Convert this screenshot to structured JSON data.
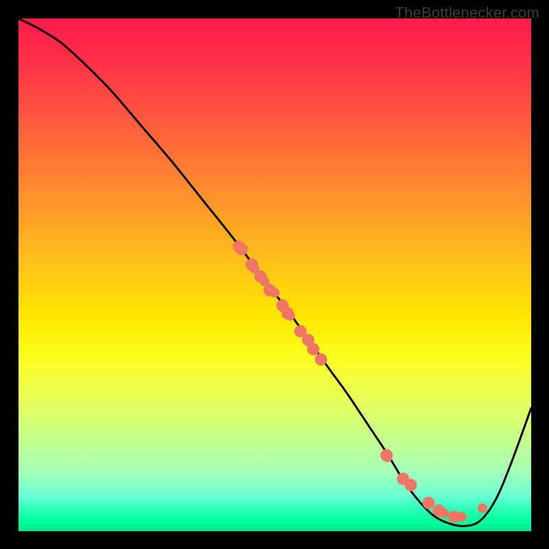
{
  "watermark": "TheBottlenecker.com",
  "chart_data": {
    "type": "line",
    "title": "",
    "xlabel": "",
    "ylabel": "",
    "xlim": [
      0,
      100
    ],
    "ylim": [
      0,
      100
    ],
    "grid": false,
    "curve": {
      "x": [
        0,
        4,
        8,
        12,
        18,
        24,
        30,
        36,
        42,
        48,
        54,
        60,
        64,
        68,
        72,
        75,
        78,
        81,
        84,
        87,
        90,
        93,
        96,
        100
      ],
      "y": [
        100,
        98,
        95.5,
        92,
        86,
        79,
        72,
        64.5,
        57,
        49,
        41,
        32.5,
        27,
        21,
        15,
        10,
        6,
        3,
        1.5,
        1,
        2,
        6,
        13,
        24
      ]
    },
    "markers": [
      {
        "x": 43.0,
        "y": 55.5,
        "r": 9
      },
      {
        "x": 43.5,
        "y": 55.0,
        "r": 9
      },
      {
        "x": 45.5,
        "y": 52.0,
        "r": 9
      },
      {
        "x": 46.0,
        "y": 51.2,
        "r": 7
      },
      {
        "x": 47.2,
        "y": 49.7,
        "r": 9
      },
      {
        "x": 48.0,
        "y": 48.7,
        "r": 7
      },
      {
        "x": 49.0,
        "y": 47.0,
        "r": 9
      },
      {
        "x": 50.0,
        "y": 46.5,
        "r": 7
      },
      {
        "x": 51.5,
        "y": 44.0,
        "r": 9
      },
      {
        "x": 52.5,
        "y": 42.5,
        "r": 9
      },
      {
        "x": 53.0,
        "y": 42.0,
        "r": 7
      },
      {
        "x": 55.0,
        "y": 39.0,
        "r": 9
      },
      {
        "x": 56.5,
        "y": 37.3,
        "r": 9
      },
      {
        "x": 57.5,
        "y": 35.5,
        "r": 9
      },
      {
        "x": 59.0,
        "y": 33.5,
        "r": 9
      },
      {
        "x": 71.8,
        "y": 14.8,
        "r": 9
      },
      {
        "x": 72.0,
        "y": 14.4,
        "r": 7
      },
      {
        "x": 75.0,
        "y": 10.2,
        "r": 9
      },
      {
        "x": 76.5,
        "y": 9.0,
        "r": 9
      },
      {
        "x": 80.0,
        "y": 5.5,
        "r": 9
      },
      {
        "x": 82.0,
        "y": 4.0,
        "r": 9
      },
      {
        "x": 83.0,
        "y": 3.5,
        "r": 7
      },
      {
        "x": 85.0,
        "y": 2.8,
        "r": 9
      },
      {
        "x": 86.5,
        "y": 2.8,
        "r": 7
      },
      {
        "x": 90.5,
        "y": 4.5,
        "r": 7
      }
    ],
    "marker_color": "#ef7565"
  }
}
